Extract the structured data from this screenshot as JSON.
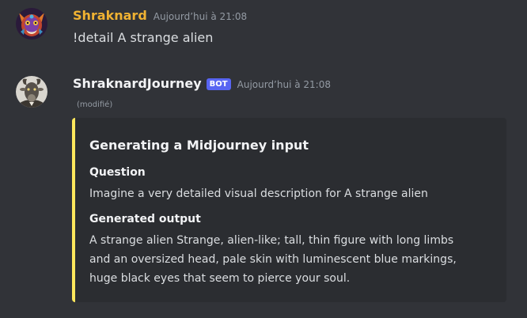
{
  "messages": [
    {
      "username": "Shraknard",
      "timestamp": "Aujourd’hui à 21:08",
      "text": "!detail A strange alien",
      "username_color": "#f0b232"
    },
    {
      "username": "ShraknardJourney",
      "bot_tag": "BOT",
      "timestamp": "Aujourd’hui à 21:08",
      "edited": "(modifié)",
      "embed": {
        "accent_color": "#fee75c",
        "title": "Generating a Midjourney input",
        "fields": [
          {
            "name": "Question",
            "value": "Imagine a very detailed visual description for A strange alien"
          },
          {
            "name": "Generated output",
            "value_lines": [
              "A strange alien Strange, alien-like; tall, thin figure with long limbs",
              "and an oversized head, pale skin with luminescent blue markings,",
              "huge black eyes that seem to pierce your soul."
            ]
          }
        ]
      }
    }
  ],
  "colors": {
    "background": "#313338",
    "embed_background": "#2b2d31",
    "bot_tag": "#5865f2",
    "timestamp": "#949ba4"
  },
  "icons": {
    "user_avatar": "demon-mask-avatar",
    "bot_avatar": "goat-avatar"
  }
}
